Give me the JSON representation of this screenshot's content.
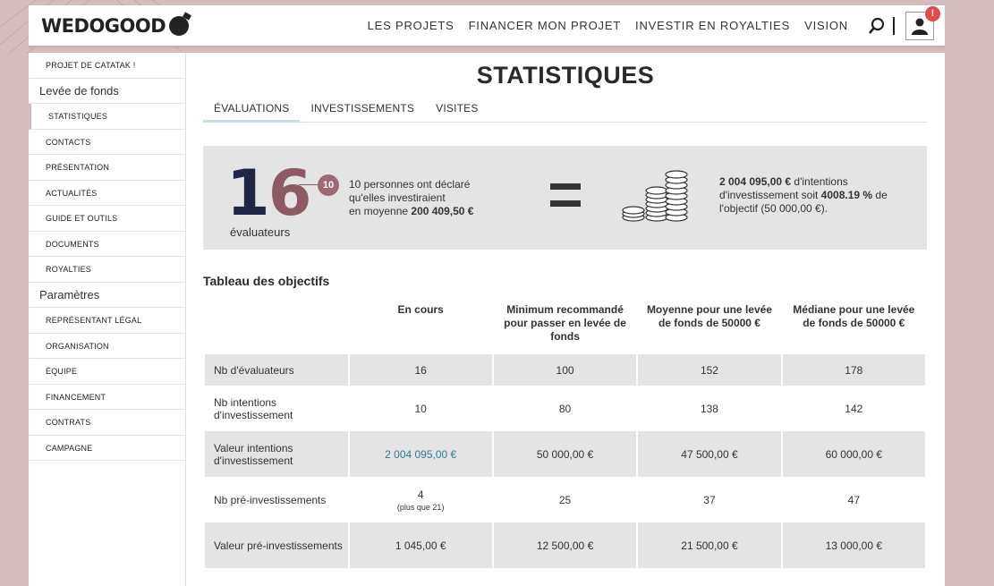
{
  "header": {
    "logo": "WEDOGOOD",
    "nav": [
      "LES PROJETS",
      "FINANCER MON PROJET",
      "INVESTIR EN ROYALTIES",
      "VISION"
    ],
    "notification_count": "!"
  },
  "sidebar": {
    "items": [
      {
        "type": "item",
        "label": "PROJET DE CATATAK !"
      },
      {
        "type": "group",
        "label": "Levée de fonds"
      },
      {
        "type": "item",
        "label": "STATISTIQUES",
        "active": true
      },
      {
        "type": "item",
        "label": "CONTACTS"
      },
      {
        "type": "item",
        "label": "PRÉSENTATION"
      },
      {
        "type": "item",
        "label": "ACTUALITÉS"
      },
      {
        "type": "item",
        "label": "GUIDE ET OUTILS"
      },
      {
        "type": "item",
        "label": "DOCUMENTS"
      },
      {
        "type": "item",
        "label": "ROYALTIES"
      },
      {
        "type": "group",
        "label": "Paramètres"
      },
      {
        "type": "item",
        "label": "REPRÉSENTANT LÉGAL"
      },
      {
        "type": "item",
        "label": "ORGANISATION"
      },
      {
        "type": "item",
        "label": "ÉQUIPE"
      },
      {
        "type": "item",
        "label": "FINANCEMENT"
      },
      {
        "type": "item",
        "label": "CONTRATS"
      },
      {
        "type": "item",
        "label": "CAMPAGNE"
      }
    ]
  },
  "main": {
    "title": "STATISTIQUES",
    "tabs": [
      "ÉVALUATIONS",
      "INVESTISSEMENTS",
      "VISITES"
    ],
    "summary": {
      "big_number_first": "1",
      "big_number_rest": "6",
      "big_label": "évaluateurs",
      "circle_value": "10",
      "decl_line1": "10 personnes ont déclaré",
      "decl_line2": "qu'elles investiraient",
      "decl_line3_prefix": "en moyenne ",
      "decl_amount": "200 409,50 €",
      "intent_amount": "2 004 095,00 €",
      "intent_mid": " d'intentions d'investissement soit ",
      "intent_percent": "4008.19 %",
      "intent_tail": " de l'objectif (50 000,00 €)."
    },
    "table": {
      "title": "Tableau des objectifs",
      "headers": [
        "",
        "En cours",
        "Minimum recommandé pour passer en levée de fonds",
        "Moyenne pour une levée de fonds de 50000 €",
        "Médiane pour une levée de fonds de 50000 €"
      ],
      "rows": [
        {
          "label": "Nb d'évaluateurs",
          "current": "16",
          "current_sub": "",
          "min": "100",
          "avg": "152",
          "median": "178"
        },
        {
          "label": "Nb intentions d'investissement",
          "current": "10",
          "current_sub": "",
          "min": "80",
          "avg": "138",
          "median": "142"
        },
        {
          "label": "Valeur intentions d'investissement",
          "current": "2 004 095,00 €",
          "current_sub": "",
          "min": "50 000,00 €",
          "avg": "47 500,00 €",
          "median": "60 000,00 €"
        },
        {
          "label": "Nb pré-investissements",
          "current": "4",
          "current_sub": "(plus que 21)",
          "min": "25",
          "avg": "37",
          "median": "47"
        },
        {
          "label": "Valeur pré-investissements",
          "current": "1 045,00 €",
          "current_sub": "",
          "min": "12 500,00 €",
          "avg": "21 500,00 €",
          "median": "13 000,00 €"
        }
      ]
    }
  },
  "colors": {
    "background": "#d5bcbd",
    "accent_mauve": "#9a6b73",
    "accent_navy": "#1f2547",
    "link_blue": "#2f7c93",
    "notification": "#e24b4b"
  }
}
